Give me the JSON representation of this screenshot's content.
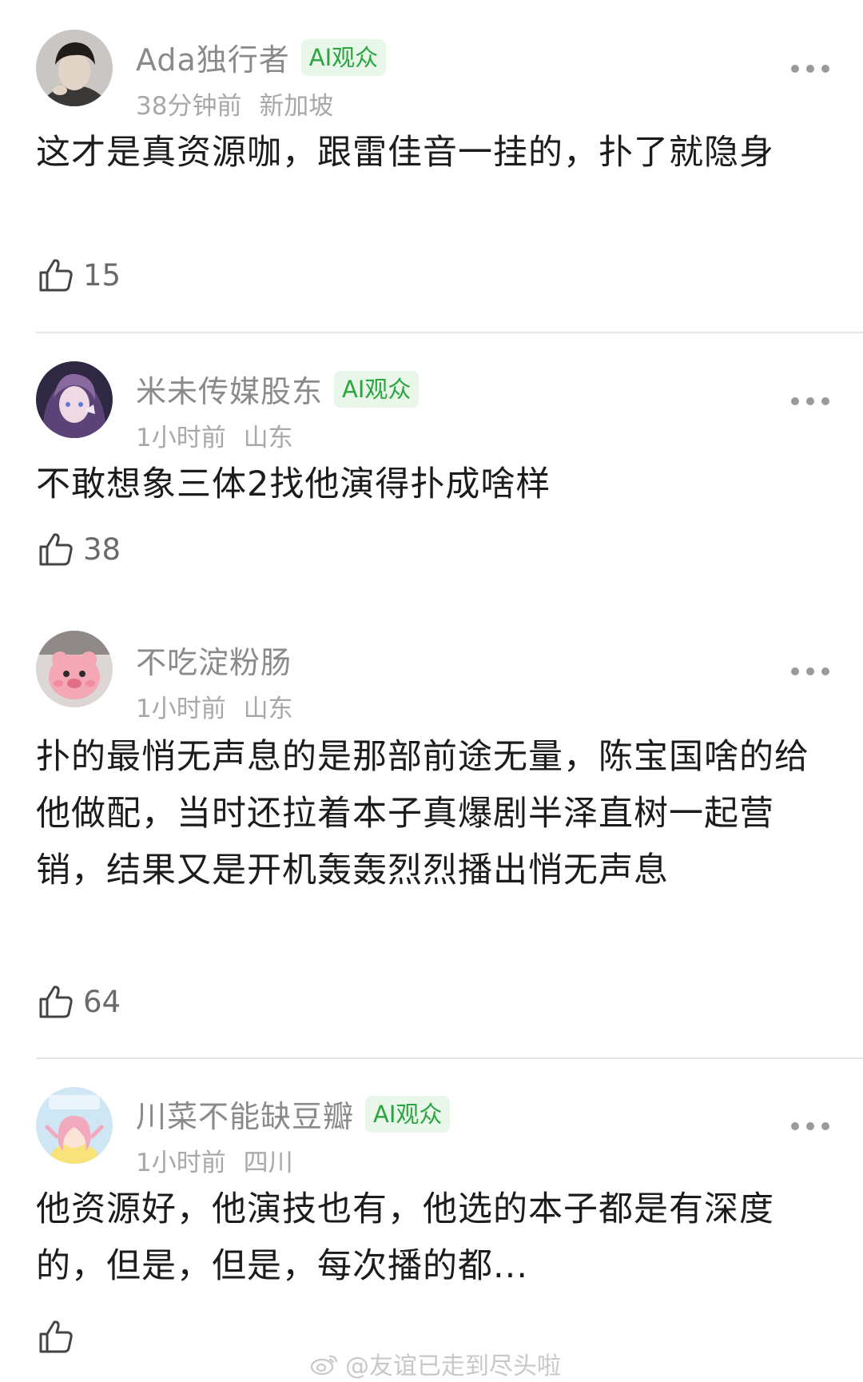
{
  "comments": [
    {
      "username": "Ada独行者",
      "badge": "AI观众",
      "time": "38分钟前",
      "location": "新加坡",
      "text": "这才是真资源咖，跟雷佳音一挂的，扑了就隐身",
      "likes": "15"
    },
    {
      "username": "米未传媒股东",
      "badge": "AI观众",
      "time": "1小时前",
      "location": "山东",
      "text": "不敢想象三体2找他演得扑成啥样",
      "likes": "38"
    },
    {
      "username": "不吃淀粉肠",
      "time": "1小时前",
      "location": "山东",
      "text": "扑的最悄无声息的是那部前途无量，陈宝国啥的给他做配，当时还拉着本子真爆剧半泽直树一起营销，结果又是开机轰轰烈烈播出悄无声息",
      "likes": "64"
    },
    {
      "username": "川菜不能缺豆瓣",
      "badge": "AI观众",
      "time": "1小时前",
      "location": "四川",
      "text": "他资源好，他演技也有，他选的本子都是有深度的，但是，但是，每次播的都..."
    }
  ],
  "watermark": "@友谊已走到尽头啦",
  "icons": {
    "more": "more-dots-icon",
    "like": "thumbs-up-icon",
    "watermark": "weibo-logo-icon"
  },
  "colors": {
    "badge_text": "#2aa53f",
    "badge_bg": "#e8f7e9",
    "username": "#8a8a8a",
    "meta": "#a8a8a8",
    "body": "#1c1c1c"
  }
}
